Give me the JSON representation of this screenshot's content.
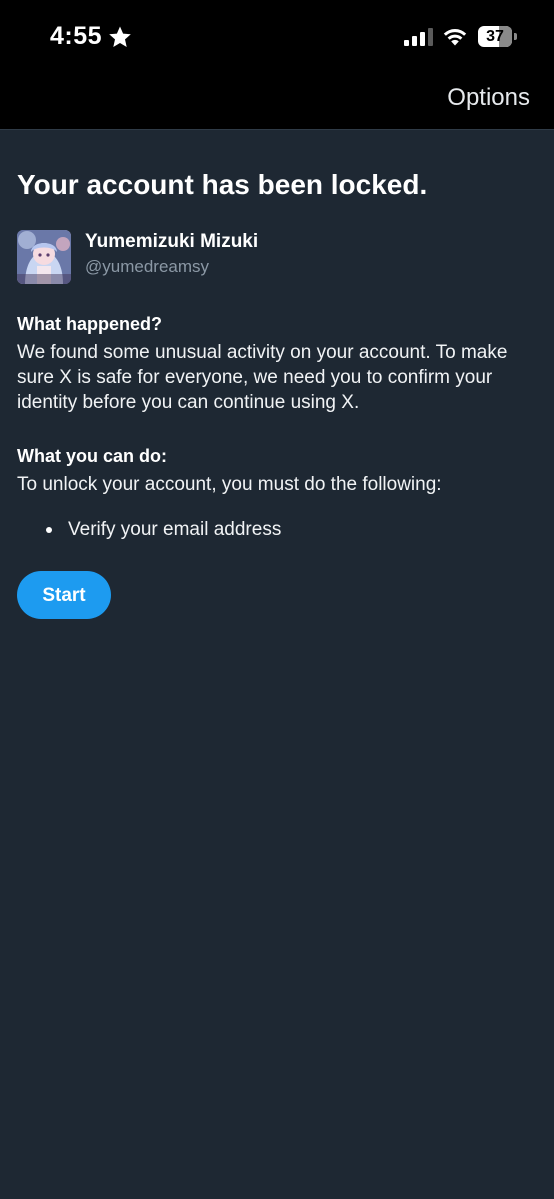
{
  "status_bar": {
    "time": "4:55",
    "battery_level": "37",
    "icons": [
      "star-icon",
      "signal-icon",
      "wifi-icon",
      "battery-icon"
    ]
  },
  "top_bar": {
    "options_label": "Options"
  },
  "main": {
    "title": "Your account has been locked.",
    "profile": {
      "display_name": "Yumemizuki Mizuki",
      "handle": "@yumedreamsy"
    },
    "what_happened": {
      "heading": "What happened?",
      "body": "We found some unusual activity on your account. To make sure X is safe for everyone, we need you to confirm your identity before you can continue using X."
    },
    "what_you_can_do": {
      "heading": "What you can do:",
      "body": "To unlock your account, you must do the following:",
      "steps": [
        "Verify your email address"
      ]
    },
    "start_label": "Start"
  },
  "colors": {
    "background": "#1e2833",
    "accent": "#1d9bf0",
    "secondary_text": "#8b98a5"
  }
}
